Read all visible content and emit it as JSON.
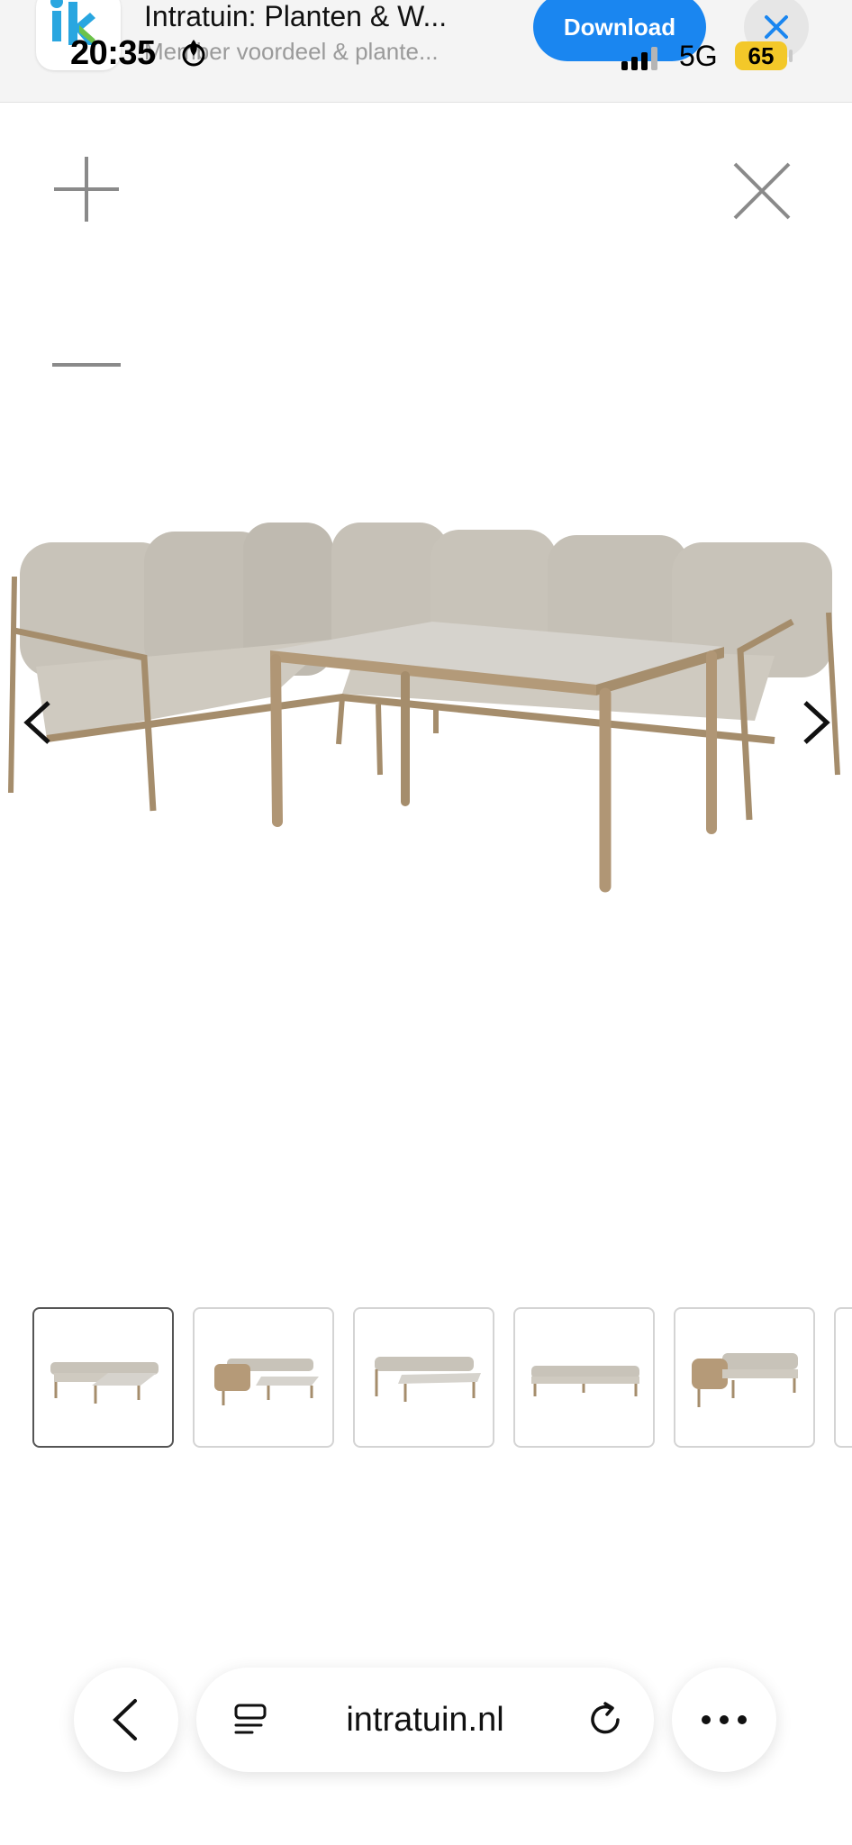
{
  "banner": {
    "app_name": "Intratuin: Planten & W...",
    "app_subtitle": "Member voordeel & plante...",
    "download_label": "Download"
  },
  "status_bar": {
    "time": "20:35",
    "network": "5G",
    "battery": "65"
  },
  "viewer": {
    "zoom_in_icon": "plus-icon",
    "zoom_out_icon": "minus-icon",
    "close_icon": "close-icon",
    "prev_icon": "chevron-left-icon",
    "next_icon": "chevron-right-icon",
    "thumbnail_count_visible": 6,
    "active_thumbnail": 1
  },
  "browser": {
    "url": "intratuin.nl",
    "back_icon": "chevron-left-icon",
    "reader_icon": "reader-icon",
    "reload_icon": "reload-icon",
    "more_icon": "more-icon"
  },
  "colors": {
    "accent": "#1a86f0",
    "battery": "#f3c829",
    "cushion": "#c9c4ba",
    "wood": "#b59a78"
  }
}
